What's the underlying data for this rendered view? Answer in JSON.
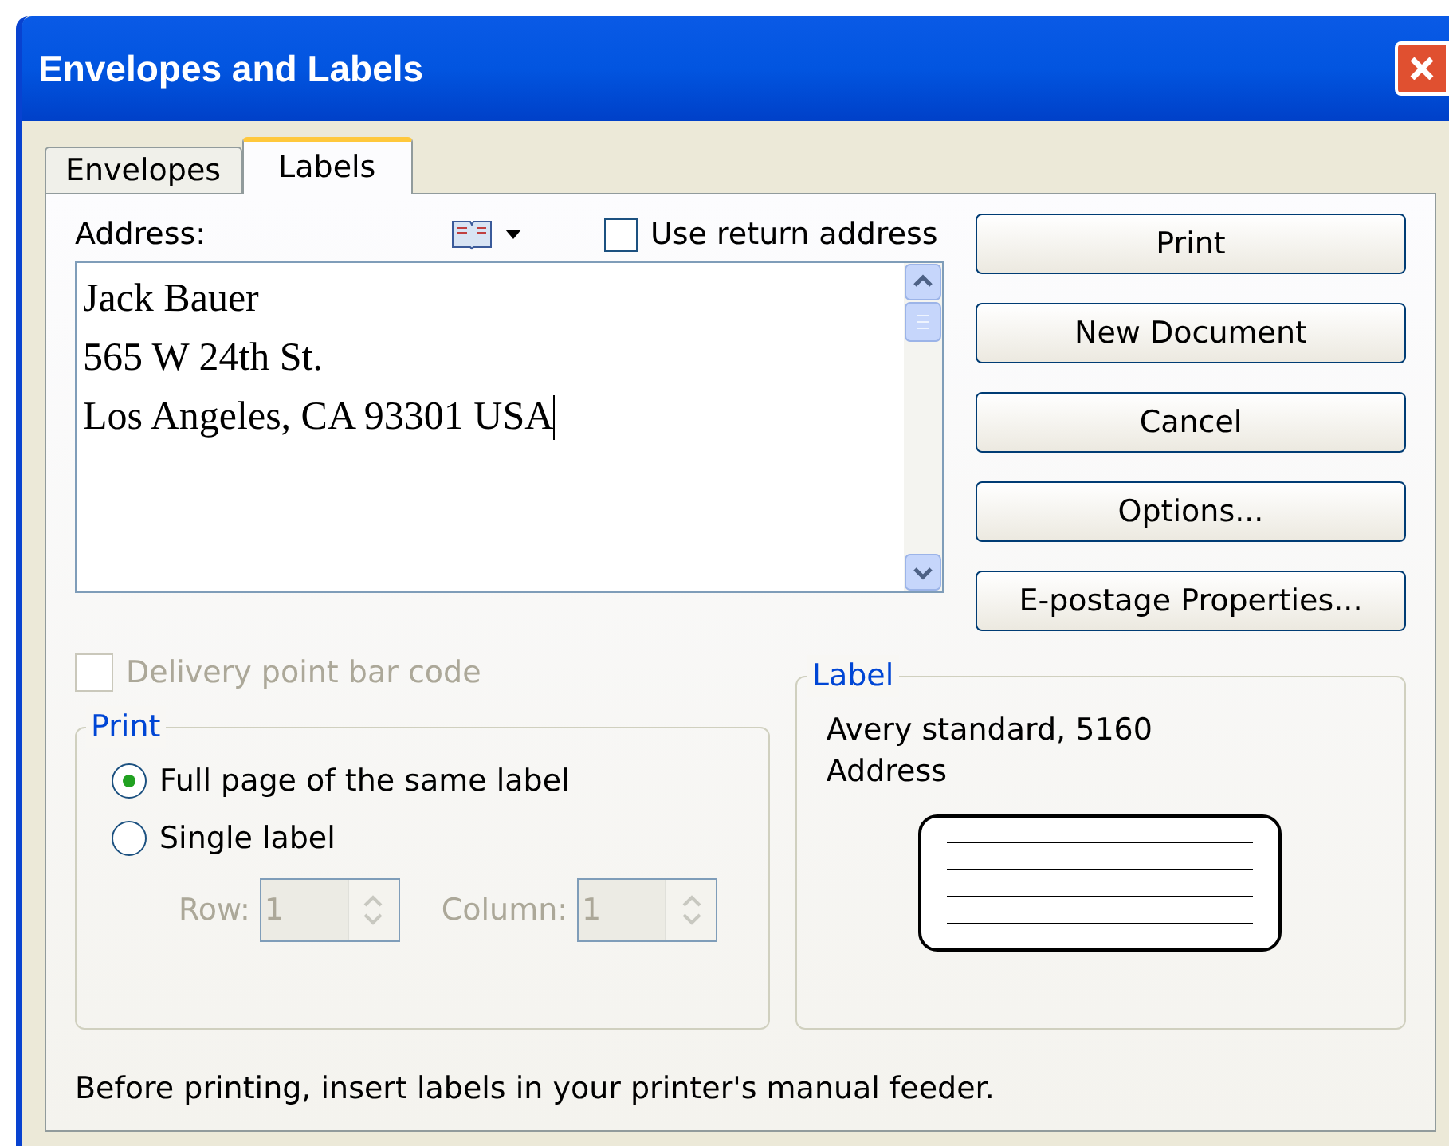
{
  "window": {
    "title": "Envelopes and Labels"
  },
  "tabs": [
    {
      "label": "Envelopes",
      "selected": false
    },
    {
      "label": "Labels",
      "selected": true
    }
  ],
  "address": {
    "label": "Address:",
    "value": [
      "Jack Bauer",
      "565 W 24th St.",
      "Los Angeles, CA 93301 USA"
    ]
  },
  "use_return_address": {
    "label": "Use return address",
    "checked": false
  },
  "buttons": [
    "Print",
    "New Document",
    "Cancel",
    "Options...",
    "E-postage Properties..."
  ],
  "delivery_point_bar_code": {
    "label": "Delivery point bar code",
    "checked": false,
    "disabled": true
  },
  "print_group": {
    "title": "Print",
    "options": [
      {
        "label": "Full page of the same label",
        "selected": true
      },
      {
        "label": "Single label",
        "selected": false
      }
    ],
    "spinners": [
      {
        "label": "Row:",
        "value": "1",
        "disabled": true
      },
      {
        "label": "Column:",
        "value": "1",
        "disabled": true
      }
    ]
  },
  "label_group": {
    "title": "Label",
    "lines": [
      "Avery standard, 5160",
      "Address"
    ]
  },
  "footer": "Before printing, insert labels in your printer's manual feeder."
}
